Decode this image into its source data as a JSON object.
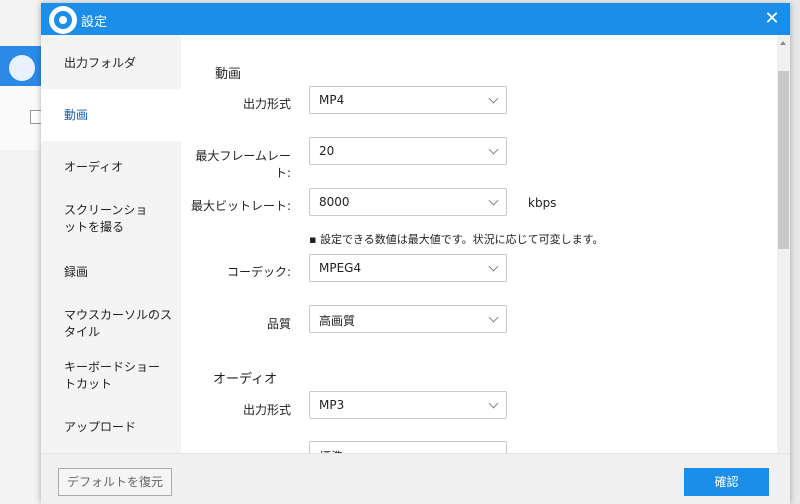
{
  "window": {
    "title": "設定"
  },
  "sidebar": {
    "items": [
      {
        "label": "出力フォルダ"
      },
      {
        "label": "動画"
      },
      {
        "label": "オーディオ"
      },
      {
        "label": "スクリーンショットを撮る"
      },
      {
        "label": "録画"
      },
      {
        "label": "マウスカーソルのスタイル"
      },
      {
        "label": "キーボードショートカット"
      },
      {
        "label": "アップロード"
      }
    ],
    "active_index": 1
  },
  "video": {
    "title": "動画",
    "format": {
      "label": "出力形式",
      "value": "MP4"
    },
    "framerate": {
      "label": "最大フレームレート:",
      "value": "20"
    },
    "bitrate": {
      "label": "最大ビットレート:",
      "value": "8000",
      "unit": "kbps"
    },
    "note": "▪ 設定できる数値は最大値です。状況に応じて可変します。",
    "codec": {
      "label": "コーデック:",
      "value": "MPEG4"
    },
    "quality": {
      "label": "品質",
      "value": "高画質"
    }
  },
  "audio": {
    "title": "オーディオ",
    "format": {
      "label": "出力形式",
      "value": "MP3"
    },
    "next_value": "標準"
  },
  "footer": {
    "reset_label": "デフォルトを復元",
    "confirm_label": "確認"
  }
}
